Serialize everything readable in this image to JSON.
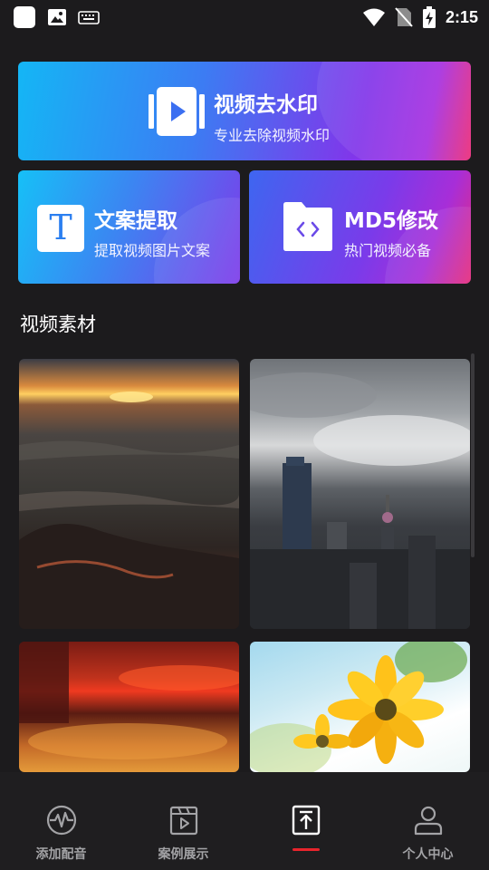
{
  "status_bar": {
    "time": "2:15"
  },
  "cards": {
    "main": {
      "title": "视频去水印",
      "subtitle": "专业去除视频水印",
      "icon": "video-play-icon"
    },
    "text_extract": {
      "title": "文案提取",
      "subtitle": "提取视频图片文案",
      "icon_glyph": "T"
    },
    "md5": {
      "title": "MD5修改",
      "subtitle": "热门视频必备",
      "icon_glyph": "< >"
    }
  },
  "section": {
    "title": "视频素材"
  },
  "materials": [
    "sunset-sea",
    "city-skyline",
    "red-light-bokeh",
    "yellow-flower"
  ],
  "bottom_nav": [
    {
      "label": "添加配音",
      "icon": "waveform-icon",
      "active": false
    },
    {
      "label": "案例展示",
      "icon": "video-clapper-icon",
      "active": false
    },
    {
      "label": "",
      "icon": "upload-icon",
      "active": true
    },
    {
      "label": "个人中心",
      "icon": "person-icon",
      "active": false
    }
  ],
  "colors": {
    "background": "#1c1b1d",
    "active_indicator": "#e8242c",
    "nav_label": "#a3a3a6"
  }
}
